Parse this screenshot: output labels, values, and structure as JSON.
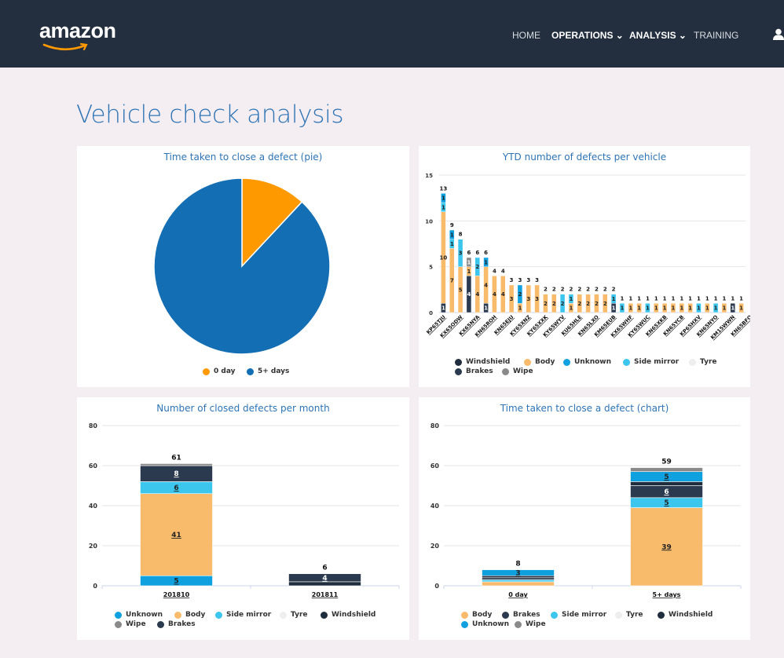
{
  "header": {
    "logo_text": "amazon",
    "nav": [
      "HOME",
      "OPERATIONS ⌄",
      "ANALYSIS ⌄",
      "TRAINING"
    ]
  },
  "page_title": "Vehicle check analysis",
  "colors": {
    "windshield": "#1f2d3d",
    "body": "#f8bb6c",
    "unknown": "#0fa0e0",
    "side_mirror": "#3cc6ee",
    "tyre": "#eeeeee",
    "brakes": "#2b3a4f",
    "wipe": "#8a8a8a",
    "pie_0day": "#ff9900",
    "pie_5plus": "#146eb4"
  },
  "pie_panel": {
    "title": "Time taken to close a defect (pie)",
    "legend": [
      "0 day",
      "5+ days"
    ]
  },
  "ytd_panel": {
    "title": "YTD number of defects per vehicle",
    "legend_row1": [
      "Windshield",
      "Body",
      "Unknown",
      "Side mirror",
      "Tyre"
    ],
    "legend_row2": [
      "Brakes",
      "Wipe"
    ]
  },
  "monthly_panel": {
    "title": "Number of closed defects per month",
    "legend_row1": [
      "Unknown",
      "Body",
      "Side mirror",
      "Tyre",
      "Windshield"
    ],
    "legend_row2": [
      "Wipe",
      "Brakes"
    ]
  },
  "time_panel": {
    "title": "Time taken to close a defect (chart)",
    "legend_row1": [
      "Body",
      "Brakes",
      "Side mirror",
      "Tyre",
      "Windshield"
    ],
    "legend_row2": [
      "Unknown",
      "Wipe"
    ]
  },
  "chart_data": [
    {
      "type": "pie",
      "title": "Time taken to close a defect (pie)",
      "labels": [
        "0 day",
        "5+ days"
      ],
      "values": [
        8,
        59
      ]
    },
    {
      "type": "bar",
      "title": "YTD number of defects per vehicle",
      "stacked": true,
      "ylim": [
        0,
        15
      ],
      "yticks": [
        0,
        5,
        10,
        15
      ],
      "categories": [
        "KP65TJU",
        "KX65ODW",
        "KX65NYA",
        "KN65ROH",
        "KN65EJU",
        "KY65XNZ",
        "KY65XXK",
        "KY65WYV",
        "KU65HLE",
        "KN65LXO",
        "KM65EUB",
        "KX65WHF",
        "KY65WUC",
        "KN65XKB",
        "KN65YCB",
        "KP65HXV",
        "KN65NYO",
        "KM15WWN",
        "KN65BFO"
      ],
      "x_all_bars": 36,
      "totals": [
        13,
        9,
        8,
        6,
        6,
        6,
        4,
        4,
        3,
        3,
        3,
        3,
        2,
        2,
        2,
        2,
        2,
        2,
        2,
        2,
        2,
        1,
        1,
        1,
        1,
        1,
        1,
        1,
        1,
        1,
        1,
        1,
        1,
        1,
        1,
        1
      ],
      "series": [
        {
          "name": "Windshield",
          "values": [
            0,
            0,
            0,
            0,
            0,
            0,
            0,
            0,
            0,
            0,
            0,
            0,
            0,
            0,
            0,
            0,
            0,
            0,
            0,
            0,
            0,
            0,
            0,
            0,
            0,
            0,
            0,
            0,
            0,
            0,
            0,
            0,
            0,
            0,
            0,
            0
          ]
        },
        {
          "name": "Brakes",
          "values": [
            1,
            0,
            0,
            4,
            0,
            1,
            0,
            0,
            0,
            0,
            0,
            0,
            0,
            0,
            0,
            0,
            0,
            0,
            0,
            0,
            1,
            0,
            0,
            0,
            0,
            0,
            0,
            0,
            0,
            0,
            0,
            0,
            0,
            0,
            1,
            0
          ]
        },
        {
          "name": "Body",
          "values": [
            10,
            7,
            5,
            1,
            4,
            4,
            4,
            4,
            3,
            1,
            3,
            3,
            2,
            2,
            0,
            1,
            2,
            2,
            2,
            2,
            0,
            0,
            1,
            1,
            0,
            1,
            1,
            1,
            1,
            1,
            0,
            1,
            0,
            1,
            0,
            1
          ]
        },
        {
          "name": "Side mirror",
          "values": [
            1,
            1,
            3,
            0,
            2,
            0,
            0,
            0,
            0,
            0,
            0,
            0,
            0,
            0,
            2,
            1,
            0,
            0,
            0,
            0,
            1,
            1,
            0,
            0,
            1,
            0,
            0,
            0,
            0,
            0,
            1,
            0,
            1,
            0,
            0,
            0
          ]
        },
        {
          "name": "Unknown",
          "values": [
            1,
            1,
            0,
            0,
            0,
            1,
            0,
            0,
            0,
            2,
            0,
            0,
            0,
            0,
            0,
            0,
            0,
            0,
            0,
            0,
            0,
            0,
            0,
            0,
            0,
            0,
            0,
            0,
            0,
            0,
            0,
            0,
            0,
            0,
            0,
            0
          ]
        },
        {
          "name": "Tyre",
          "values": [
            0,
            0,
            0,
            0,
            0,
            0,
            0,
            0,
            0,
            0,
            0,
            0,
            0,
            0,
            0,
            0,
            0,
            0,
            0,
            0,
            0,
            0,
            0,
            0,
            0,
            0,
            0,
            0,
            0,
            0,
            0,
            0,
            0,
            0,
            0,
            0
          ]
        },
        {
          "name": "Wipe",
          "values": [
            0,
            0,
            0,
            1,
            0,
            0,
            0,
            0,
            0,
            0,
            0,
            0,
            0,
            0,
            0,
            0,
            0,
            0,
            0,
            0,
            0,
            0,
            0,
            0,
            0,
            0,
            0,
            0,
            0,
            0,
            0,
            0,
            0,
            0,
            0,
            0
          ]
        }
      ],
      "segment_labels": [
        [
          1,
          10,
          1,
          1
        ],
        [
          7,
          1,
          1
        ],
        [
          5,
          3
        ],
        [
          4,
          1,
          1
        ],
        [
          4,
          2
        ],
        [
          1,
          4,
          1
        ],
        [
          4
        ],
        [
          4
        ],
        [
          3
        ],
        [
          1,
          2
        ],
        [
          3
        ],
        [
          3
        ],
        [
          2
        ],
        [
          2
        ],
        [
          2
        ],
        [
          1,
          1
        ],
        [
          2
        ],
        [
          2
        ],
        [
          2
        ],
        [
          2
        ],
        [
          1,
          1
        ],
        [
          1
        ],
        [
          1
        ],
        [
          1
        ],
        [
          1
        ],
        [
          1
        ],
        [
          1
        ],
        [
          1
        ],
        [
          1
        ],
        [
          1
        ],
        [
          1
        ],
        [
          1
        ],
        [
          1
        ],
        [
          1
        ],
        [
          1
        ],
        [
          1
        ]
      ]
    },
    {
      "type": "bar",
      "title": "Number of closed defects per month",
      "stacked": true,
      "ylim": [
        0,
        80
      ],
      "yticks": [
        0,
        20,
        40,
        60,
        80
      ],
      "categories": [
        "201810",
        "201811"
      ],
      "totals": [
        61,
        6
      ],
      "series": [
        {
          "name": "Unknown",
          "values": [
            5,
            0
          ]
        },
        {
          "name": "Body",
          "values": [
            41,
            0
          ]
        },
        {
          "name": "Side mirror",
          "values": [
            6,
            0
          ]
        },
        {
          "name": "Tyre",
          "values": [
            0,
            0
          ]
        },
        {
          "name": "Windshield",
          "values": [
            0,
            2
          ]
        },
        {
          "name": "Brakes",
          "values": [
            8,
            4
          ]
        },
        {
          "name": "Wipe",
          "values": [
            1,
            0
          ]
        }
      ],
      "segment_labels": [
        {
          "Unknown": "5",
          "Body": "41",
          "Side mirror": "6",
          "Brakes": "8"
        },
        {
          "Brakes": "4"
        }
      ]
    },
    {
      "type": "bar",
      "title": "Time taken to close a defect (chart)",
      "stacked": true,
      "ylim": [
        0,
        80
      ],
      "yticks": [
        0,
        20,
        40,
        60,
        80
      ],
      "categories": [
        "0 day",
        "5+ days"
      ],
      "totals": [
        8,
        59
      ],
      "series": [
        {
          "name": "Body",
          "values": [
            2,
            39
          ]
        },
        {
          "name": "Side mirror",
          "values": [
            1,
            5
          ]
        },
        {
          "name": "Brakes",
          "values": [
            1,
            6
          ]
        },
        {
          "name": "Windshield",
          "values": [
            1,
            2
          ]
        },
        {
          "name": "Unknown",
          "values": [
            3,
            5
          ]
        },
        {
          "name": "Tyre",
          "values": [
            0,
            0
          ]
        },
        {
          "name": "Wipe",
          "values": [
            0,
            2
          ]
        }
      ],
      "segment_labels": [
        {
          "Unknown": "3"
        },
        {
          "Body": "39",
          "Side mirror": "5",
          "Brakes": "6",
          "Unknown": "5"
        }
      ]
    }
  ]
}
